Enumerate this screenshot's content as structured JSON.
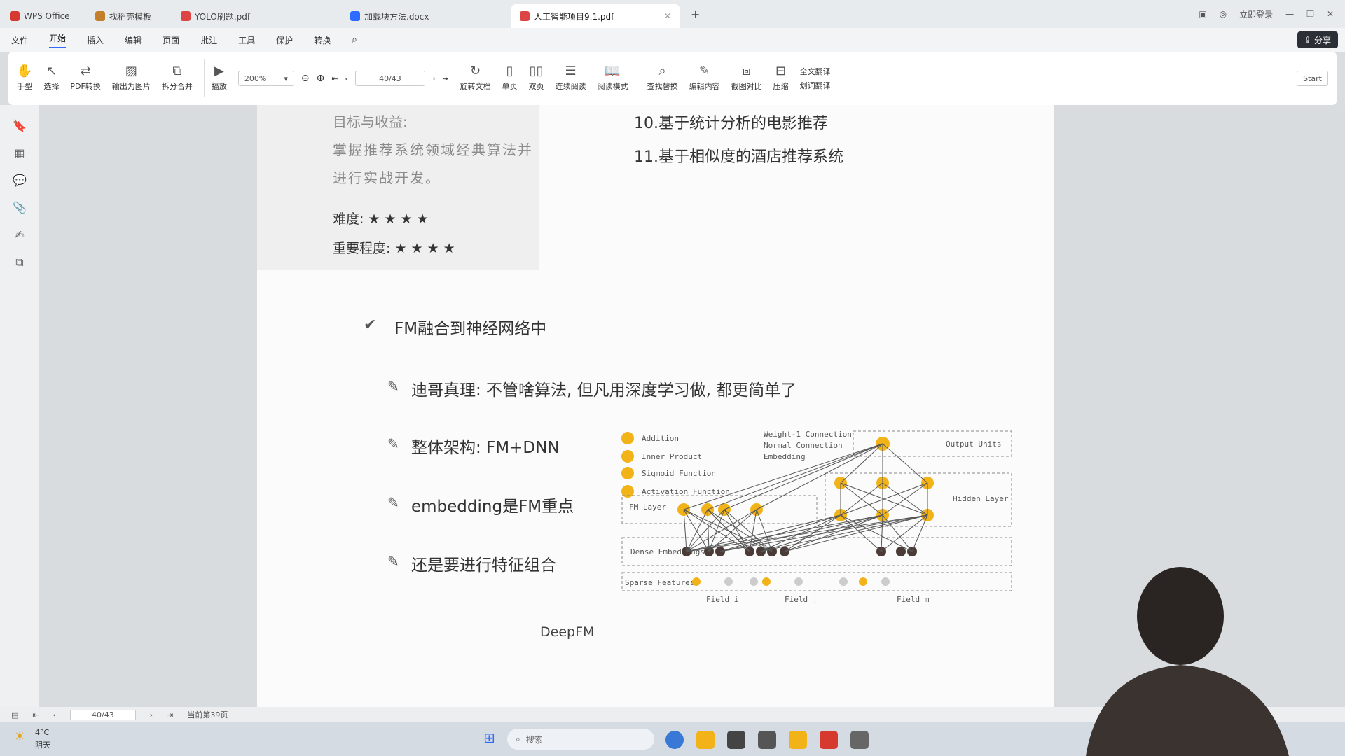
{
  "tabs": [
    {
      "label": "WPS Office",
      "color": "#d63a2f"
    },
    {
      "label": "找稻壳模板",
      "color": "#c47f2a"
    },
    {
      "label": "YOLO刷题.pdf",
      "color": "#d44"
    },
    {
      "label": "加载块方法.docx",
      "color": "#2f6bff"
    },
    {
      "label": "人工智能项目9.1.pdf",
      "color": "#d44"
    }
  ],
  "window": {
    "login": "立即登录",
    "share": "分享"
  },
  "menu": [
    "文件",
    "开始",
    "插入",
    "编辑",
    "页面",
    "批注",
    "工具",
    "保护",
    "转换"
  ],
  "menu_active": "开始",
  "ribbon": {
    "hand": "手型",
    "select": "选择",
    "pdf_convert": "PDF转换",
    "export_img": "输出为图片",
    "split_merge": "拆分合并",
    "play": "播放",
    "zoom": "200%",
    "page_counter": "40/43",
    "rotate": "旋转文档",
    "single": "单页",
    "double": "双页",
    "continuous": "连续阅读",
    "reading": "阅读模式",
    "find_replace": "查找替换",
    "edit_content": "编辑内容",
    "compare": "截图对比",
    "compress": "压缩",
    "full_translate": "全文翻译",
    "translate": "划词翻译",
    "start": "Start"
  },
  "doc": {
    "goal_title": "目标与收益:",
    "goal_text_1": "掌握推荐系统领域经典算法并",
    "goal_text_2": "进行实战开发。",
    "difficulty": "难度: ★ ★ ★ ★",
    "importance": "重要程度: ★ ★ ★ ★",
    "item10": "10.基于统计分析的电影推荐",
    "item11": "11.基于相似度的酒店推荐系统",
    "section": "FM融合到神经网络中",
    "b1": "迪哥真理: 不管啥算法, 但凡用深度学习做, 都更简单了",
    "b2": "整体架构: FM+DNN",
    "b3": "embedding是FM重点",
    "b4": "还是要进行特征组合",
    "caption": "DeepFM"
  },
  "diagram": {
    "legend": [
      "Addition",
      "Inner Product",
      "Sigmoid Function",
      "Activation Function"
    ],
    "conn": [
      "Weight-1 Connection",
      "Normal Connection",
      "Embedding"
    ],
    "output": "Output Units",
    "hidden": "Hidden Layer",
    "fm": "FM Layer",
    "dense": "Dense Embeddings",
    "sparse": "Sparse Features",
    "fields": [
      "Field i",
      "Field j",
      "Field m"
    ],
    "dots": "..."
  },
  "status": {
    "page": "40/43",
    "text": "当前第39页"
  },
  "taskbar": {
    "weather": "4°C",
    "weather2": "阴天",
    "search": "搜索"
  }
}
